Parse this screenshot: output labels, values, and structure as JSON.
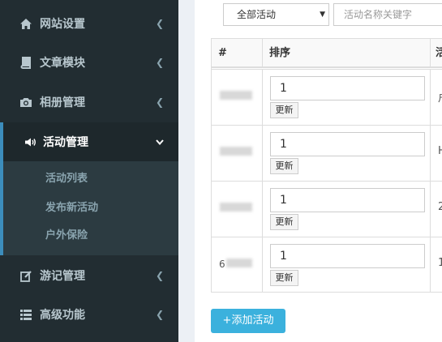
{
  "sidebar": {
    "items": [
      {
        "label": "网站设置",
        "icon": "home-icon"
      },
      {
        "label": "文章模块",
        "icon": "book-icon"
      },
      {
        "label": "相册管理",
        "icon": "camera-icon"
      },
      {
        "label": "活动管理",
        "icon": "bullhorn-icon",
        "active": true
      },
      {
        "label": "游记管理",
        "icon": "edit-icon"
      },
      {
        "label": "高级功能",
        "icon": "list-icon"
      }
    ],
    "submenu": [
      "活动列表",
      "发布新活动",
      "户外保险"
    ]
  },
  "filter": {
    "select_value": "全部活动",
    "search_placeholder": "活动名称关键字"
  },
  "table": {
    "headers": [
      "#",
      "排序",
      "活"
    ],
    "rows": [
      {
        "id_prefix": "",
        "sort": "1",
        "col3": "户"
      },
      {
        "id_prefix": "",
        "sort": "1",
        "col3": "H"
      },
      {
        "id_prefix": "",
        "sort": "1",
        "col3": "2"
      },
      {
        "id_prefix": "6",
        "sort": "1",
        "col3": "1"
      }
    ],
    "update_label": "更新"
  },
  "add_button": "+添加活动",
  "colors": {
    "sidebar_bg": "#222d32",
    "accent": "#3c8dbc",
    "add_button": "#3bb1dd"
  }
}
